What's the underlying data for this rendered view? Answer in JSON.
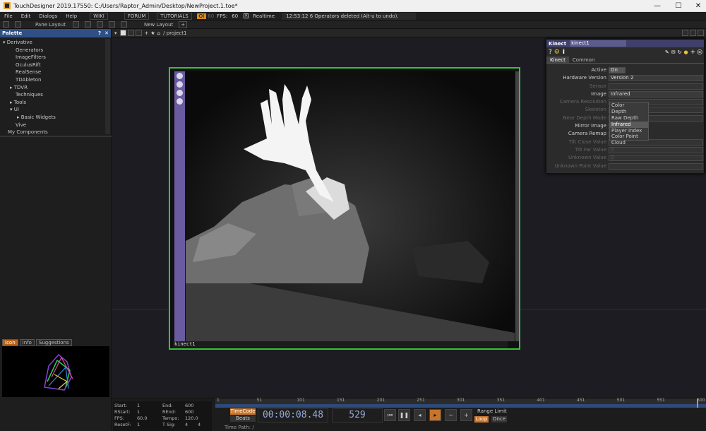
{
  "window": {
    "title": "TouchDesigner 2019.17550: C:/Users/Raptor_Admin/Desktop/NewProject.1.toe*",
    "minimize": "—",
    "maximize": "☐",
    "close": "✕"
  },
  "menu": {
    "items": [
      "File",
      "Edit",
      "Dialogs",
      "Help"
    ],
    "buttons": [
      "WIKI",
      "FORUM",
      "TUTORIALS"
    ],
    "oi": "OI",
    "fps_num": "60",
    "fps_label": "FPS:",
    "fps_val": "60",
    "realtime": "Realtime",
    "status": "12:53:12 6 Operators deleted (Alt-u to undo)."
  },
  "toolbar": {
    "pane_layout": "Pane Layout",
    "new_layout": "New Layout",
    "plus": "+"
  },
  "palette": {
    "title": "Palette",
    "items": [
      "Derivative",
      "Generators",
      "ImageFilters",
      "OculusRift",
      "RealSense",
      "TDAbleton",
      "TDVR",
      "Techniques",
      "Tools",
      "UI",
      "Basic Widgets",
      "Vive",
      "My Components"
    ]
  },
  "info_tabs": [
    "Icon",
    "Info",
    "Suggestions"
  ],
  "network": {
    "path": "/ project1",
    "node_name": "kinect1"
  },
  "params": {
    "op_type": "Kinect",
    "op_name": "kinect1",
    "tabs": [
      "Kinect",
      "Common"
    ],
    "rows": [
      {
        "label": "Active",
        "value": "On",
        "dim": false
      },
      {
        "label": "Hardware Version",
        "value": "Version 2",
        "dim": false
      },
      {
        "label": "Sensor",
        "value": "",
        "dim": true
      },
      {
        "label": "Image",
        "value": "Infrared",
        "dim": false
      },
      {
        "label": "Camera Resolution",
        "value": "",
        "dim": true
      },
      {
        "label": "Skeleton",
        "value": "",
        "dim": true
      },
      {
        "label": "Near Depth Mode",
        "value": "",
        "dim": true
      },
      {
        "label": "Mirror Image",
        "value": "",
        "dim": false
      },
      {
        "label": "Camera Remap",
        "value": "",
        "dim": false
      },
      {
        "label": "Tilt Close Value",
        "value": "0",
        "dim": true
      },
      {
        "label": "Tilt Far Value",
        "value": "0",
        "dim": true
      },
      {
        "label": "Unknown Value",
        "value": "0",
        "dim": true
      },
      {
        "label": "Unknown Point Value",
        "value": "",
        "dim": true
      }
    ],
    "dropdown": [
      "Color",
      "Depth",
      "Raw Depth",
      "Infrared",
      "Player Index",
      "Color Point Cloud"
    ],
    "dropdown_selected": "Infrared"
  },
  "stats": {
    "start_l": "Start:",
    "start_v": "1",
    "end_l": "End:",
    "end_v": "600",
    "rstart_l": "RStart:",
    "rstart_v": "1",
    "rend_l": "REnd:",
    "rend_v": "600",
    "fps_l": "FPS:",
    "fps_v": "60.0",
    "tempo_l": "Tempo:",
    "tempo_v": "120.0",
    "resetf_l": "ResetF:",
    "resetf_v": "1",
    "tsig_l": "T Sig:",
    "tsig_a": "4",
    "tsig_b": "4"
  },
  "timeline": {
    "ticks": [
      "1",
      "51",
      "101",
      "151",
      "201",
      "251",
      "301",
      "351",
      "401",
      "451",
      "501",
      "551",
      "600"
    ],
    "timecode_btn": "TimeCode",
    "beats_btn": "Beats",
    "timecode": "00:00:08.48",
    "frame": "529",
    "range_limit": "Range Limit",
    "loop": "Loop",
    "once": "Once",
    "time_path": "Time Path: /"
  },
  "colors": {
    "node_border": "#35c435",
    "accent": "#b5651d",
    "palette_header": "#2f4f86"
  }
}
